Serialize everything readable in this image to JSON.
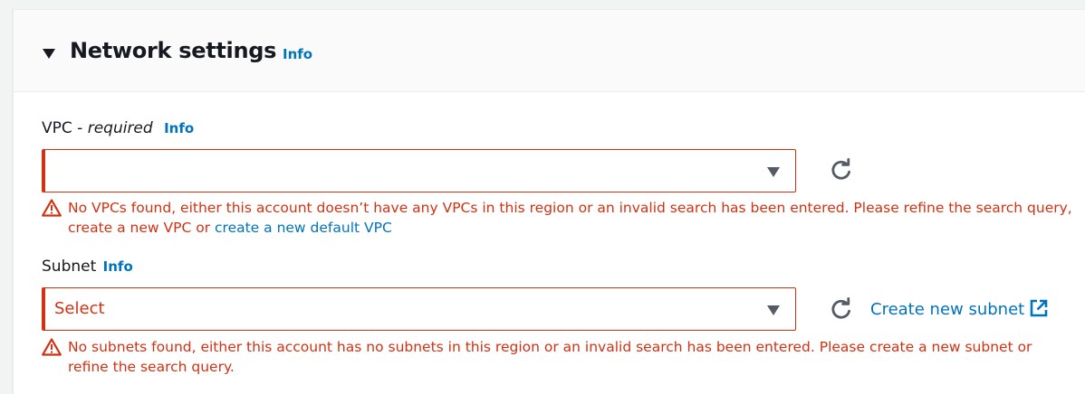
{
  "section": {
    "title": "Network settings",
    "info": "Info"
  },
  "vpc": {
    "label": "VPC - ",
    "label_required": "required",
    "info": "Info",
    "selected_value": "",
    "error_text": "No VPCs found, either this account doesn’t have any VPCs in this region or an invalid search has been entered. Please refine the search query, create a new VPC or ",
    "error_link": "create a new default VPC"
  },
  "subnet": {
    "label": "Subnet",
    "info": "Info",
    "selected_value": "Select",
    "create_link": "Create new subnet",
    "error_text": "No subnets found, either this account has no subnets in this region or an invalid search has been entered. Please create a new subnet or refine the search query."
  },
  "colors": {
    "error": "#d13212",
    "link": "#0073bb",
    "text": "#16191f"
  },
  "icons": [
    "caret-down-icon",
    "refresh-icon",
    "warning-icon",
    "external-link-icon",
    "dropdown-arrow-icon"
  ]
}
